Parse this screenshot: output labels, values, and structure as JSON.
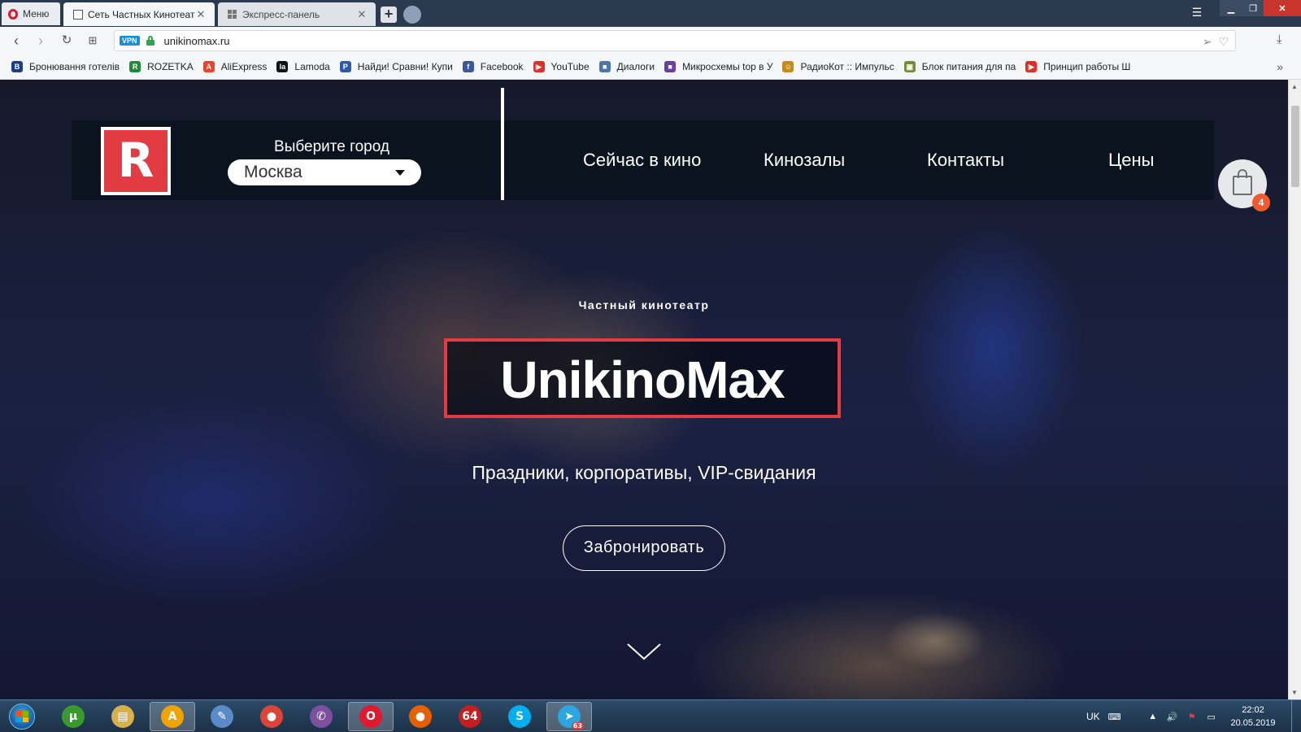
{
  "browser": {
    "menu_label": "Меню",
    "tabs": [
      {
        "title": "Сеть Частных Кинотеатров UnikinoMax",
        "active": true
      },
      {
        "title": "Экспресс-панель",
        "active": false
      }
    ],
    "new_tab": "+",
    "url": "unikinomax.ru",
    "vpn_label": "VPN",
    "bookmarks": [
      {
        "label": "Бронювання готелів",
        "icon": "booking-icon",
        "color": "#1a3e8a",
        "glyph": "B"
      },
      {
        "label": "ROZETKA",
        "icon": "rozetka-icon",
        "color": "#1f8a3a",
        "glyph": "R"
      },
      {
        "label": "AliExpress",
        "icon": "aliexpress-icon",
        "color": "#e8452c",
        "glyph": "A"
      },
      {
        "label": "Lamoda",
        "icon": "lamoda-icon",
        "color": "#111111",
        "glyph": "la"
      },
      {
        "label": "Найди! Сравни! Купи",
        "icon": "compare-icon",
        "color": "#2a5aa8",
        "glyph": "P"
      },
      {
        "label": "Facebook",
        "icon": "facebook-icon",
        "color": "#3b5998",
        "glyph": "f"
      },
      {
        "label": "YouTube",
        "icon": "youtube-icon",
        "color": "#e52d27",
        "glyph": "▶"
      },
      {
        "label": "Диалоги",
        "icon": "dialogs-icon",
        "color": "#4a76a8",
        "glyph": "■"
      },
      {
        "label": "Микросхемы top в У",
        "icon": "chip-icon",
        "color": "#6a3fa0",
        "glyph": "■"
      },
      {
        "label": "РадиоКот :: Импульс",
        "icon": "radiokot-icon",
        "color": "#c48a1a",
        "glyph": "☺"
      },
      {
        "label": "Блок питания для па",
        "icon": "power-supply-icon",
        "color": "#7a8a3a",
        "glyph": "▣"
      },
      {
        "label": "Принцип работы Ш",
        "icon": "youtube-icon",
        "color": "#e52d27",
        "glyph": "▶"
      }
    ]
  },
  "site": {
    "logo_letter": "R",
    "city_label": "Выберите город",
    "city_value": "Москва",
    "nav": [
      "Сейчас в кино",
      "Кинозалы",
      "Контакты",
      "Цены"
    ],
    "cart_count": "4",
    "hero_subtitle": "Частный кинотеатр",
    "hero_title": "UnikinoMax",
    "hero_tagline": "Праздники, корпоративы, VIP-свидания",
    "book_button": "Забронировать",
    "accent_color": "#e23b42"
  },
  "taskbar": {
    "apps": [
      {
        "name": "utorrent-icon",
        "glyph": "µ",
        "color": "#3b9a2f",
        "active": false
      },
      {
        "name": "file-explorer-icon",
        "glyph": "▤",
        "color": "#d8b04a",
        "active": false
      },
      {
        "name": "aimp-icon",
        "glyph": "A",
        "color": "#f0a400",
        "active": true
      },
      {
        "name": "paint-icon",
        "glyph": "✎",
        "color": "#5a8ac8",
        "active": false
      },
      {
        "name": "chrome-icon",
        "glyph": "●",
        "color": "#db4437",
        "active": false
      },
      {
        "name": "viber-icon",
        "glyph": "✆",
        "color": "#7b519d",
        "active": false
      },
      {
        "name": "opera-icon",
        "glyph": "O",
        "color": "#e0192e",
        "active": true
      },
      {
        "name": "firefox-icon",
        "glyph": "●",
        "color": "#e66000",
        "active": false
      },
      {
        "name": "aida64-icon",
        "glyph": "64",
        "color": "#c41e1e",
        "active": false
      },
      {
        "name": "skype-icon",
        "glyph": "S",
        "color": "#00aff0",
        "active": false
      },
      {
        "name": "telegram-icon",
        "glyph": "➤",
        "color": "#2ca5e0",
        "active": true,
        "badge": "63"
      }
    ],
    "lang": "UK",
    "time": "22:02",
    "date": "20.05.2019"
  }
}
